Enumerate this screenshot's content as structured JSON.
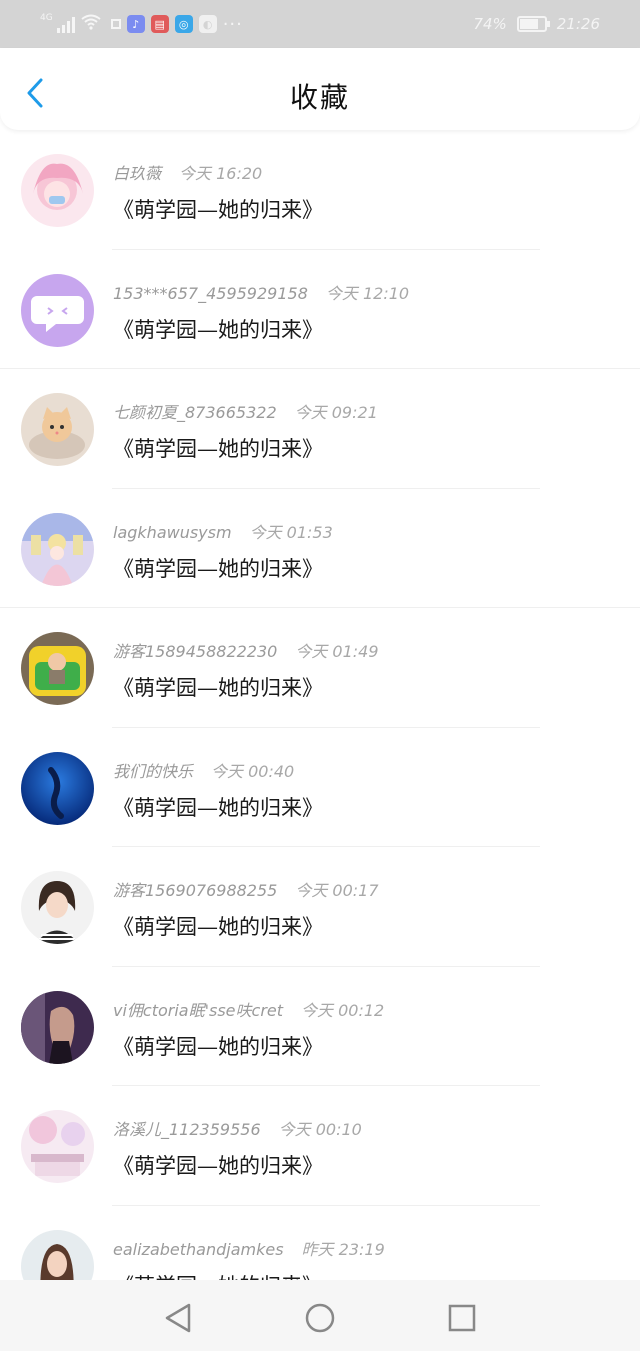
{
  "status": {
    "network": "4G",
    "more": "···",
    "battery_pct": "74%",
    "battery_level": 0.74,
    "time": "21:26",
    "apps": [
      {
        "icon": "music-app-icon",
        "color": "#7b8cf0",
        "glyph": "♪"
      },
      {
        "icon": "reader-app-icon",
        "color": "#e05a5a",
        "glyph": "▤"
      },
      {
        "icon": "browser-app-icon",
        "color": "#3aa7e8",
        "glyph": "◎"
      },
      {
        "icon": "wechat-icon",
        "color": "#f0f0f0",
        "glyph": "◐"
      }
    ]
  },
  "header": {
    "title": "收藏"
  },
  "items": [
    {
      "user": "白玖薇",
      "time": "今天 16:20",
      "title": "《萌学园—她的归来》",
      "avatar": "pink-anime-girl-avatar"
    },
    {
      "user": "153***657_4595929158",
      "time": "今天 12:10",
      "title": "《萌学园—她的归来》",
      "avatar": "purple-chat-face-avatar"
    },
    {
      "user": "七颜初夏_873665322",
      "time": "今天 09:21",
      "title": "《萌学园—她的归来》",
      "avatar": "kitten-avatar"
    },
    {
      "user": "lagkhawusysm",
      "time": "今天 01:53",
      "title": "《萌学园—她的归来》",
      "avatar": "pastel-castle-avatar"
    },
    {
      "user": "游客1589458822230",
      "time": "今天 01:49",
      "title": "《萌学园—她的归来》",
      "avatar": "child-in-toy-car-avatar"
    },
    {
      "user": "我们的快乐",
      "time": "今天 00:40",
      "title": "《萌学园—她的归来》",
      "avatar": "blue-ocean-avatar"
    },
    {
      "user": "游客1569076988255",
      "time": "今天 00:17",
      "title": "《萌学园—她的归来》",
      "avatar": "woman-portrait-avatar"
    },
    {
      "user": "vi佣ctoria眠'sse呋cret",
      "time": "今天 00:12",
      "title": "《萌学园—她的归来》",
      "avatar": "girl-purple-night-avatar"
    },
    {
      "user": "洛溪儿_112359556",
      "time": "今天 00:10",
      "title": "《萌学园—她的归来》",
      "avatar": "pink-scenery-avatar"
    },
    {
      "user": "ealizabethandjamkes",
      "time": "昨天 23:19",
      "title": "《萌学园—她的归来》",
      "avatar": "woman-brown-hair-avatar"
    }
  ]
}
